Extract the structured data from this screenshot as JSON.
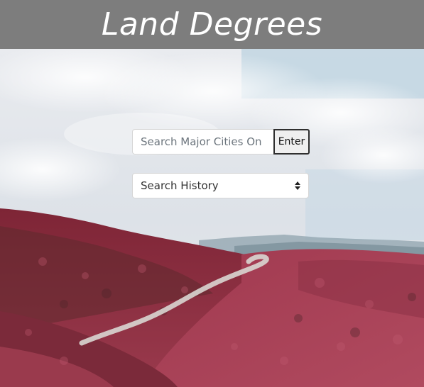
{
  "header": {
    "title": "Land Degrees"
  },
  "search": {
    "placeholder": "Search Major Cities On",
    "value": "",
    "enter_label": "Enter"
  },
  "history": {
    "selected": "Search History"
  },
  "background": {
    "description_icon": "landscape-photo",
    "colors": {
      "sky": "#dfe3e9",
      "hills": "#8c2f42",
      "road": "#d8d6d2",
      "header": "#7d7d7d"
    }
  }
}
